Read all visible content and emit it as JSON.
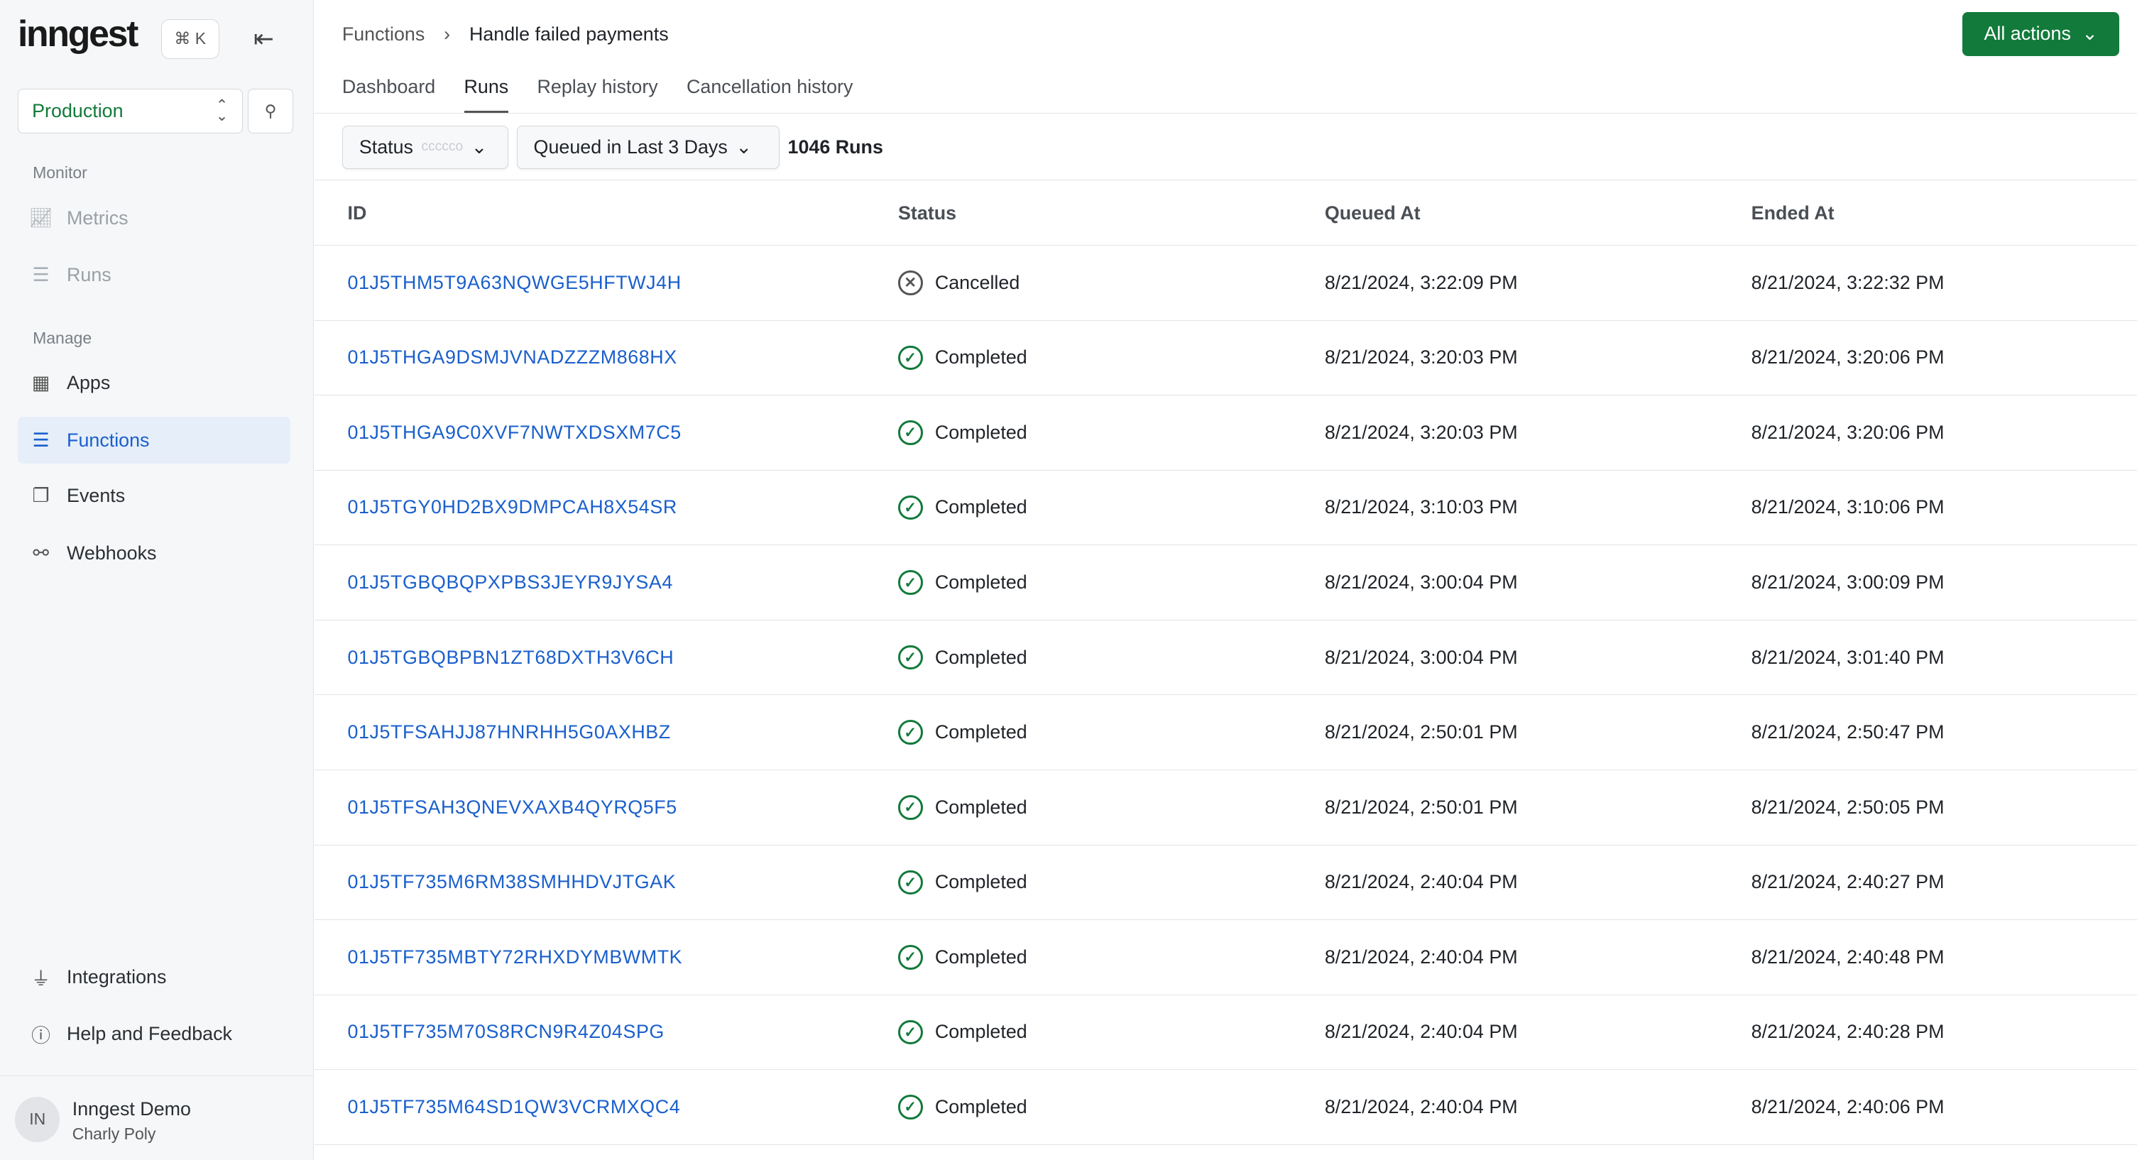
{
  "sidebar": {
    "logo": "inngest",
    "shortcut": "⌘ K",
    "environment": "Production",
    "monitor_label": "Monitor",
    "manage_label": "Manage",
    "items": {
      "metrics": "Metrics",
      "runs": "Runs",
      "apps": "Apps",
      "functions": "Functions",
      "events": "Events",
      "webhooks": "Webhooks",
      "integrations": "Integrations",
      "help": "Help and Feedback"
    },
    "user": {
      "initials": "IN",
      "name": "Inngest Demo",
      "org": "Charly Poly"
    }
  },
  "header": {
    "breadcrumb": [
      "Functions",
      "Handle failed payments"
    ],
    "all_actions": "All actions"
  },
  "tabs": [
    "Dashboard",
    "Runs",
    "Replay history",
    "Cancellation history"
  ],
  "filters": {
    "status": "Status",
    "status_placeholder": "ccccco",
    "time": "Queued in Last 3 Days",
    "count": "1046 Runs"
  },
  "table": {
    "headers": [
      "ID",
      "Status",
      "Queued At",
      "Ended At"
    ],
    "rows": [
      {
        "id": "01J5THM5T9A63NQWGE5HFTWJ4H",
        "status": "Cancelled",
        "queued": "8/21/2024, 3:22:09 PM",
        "ended": "8/21/2024, 3:22:32 PM"
      },
      {
        "id": "01J5THGA9DSMJVNADZZZM868HX",
        "status": "Completed",
        "queued": "8/21/2024, 3:20:03 PM",
        "ended": "8/21/2024, 3:20:06 PM"
      },
      {
        "id": "01J5THGA9C0XVF7NWTXDSXM7C5",
        "status": "Completed",
        "queued": "8/21/2024, 3:20:03 PM",
        "ended": "8/21/2024, 3:20:06 PM"
      },
      {
        "id": "01J5TGY0HD2BX9DMPCAH8X54SR",
        "status": "Completed",
        "queued": "8/21/2024, 3:10:03 PM",
        "ended": "8/21/2024, 3:10:06 PM"
      },
      {
        "id": "01J5TGBQBQPXPBS3JEYR9JYSA4",
        "status": "Completed",
        "queued": "8/21/2024, 3:00:04 PM",
        "ended": "8/21/2024, 3:00:09 PM"
      },
      {
        "id": "01J5TGBQBPBN1ZT68DXTH3V6CH",
        "status": "Completed",
        "queued": "8/21/2024, 3:00:04 PM",
        "ended": "8/21/2024, 3:01:40 PM"
      },
      {
        "id": "01J5TFSAHJJ87HNRHH5G0AXHBZ",
        "status": "Completed",
        "queued": "8/21/2024, 2:50:01 PM",
        "ended": "8/21/2024, 2:50:47 PM"
      },
      {
        "id": "01J5TFSAH3QNEVXAXB4QYRQ5F5",
        "status": "Completed",
        "queued": "8/21/2024, 2:50:01 PM",
        "ended": "8/21/2024, 2:50:05 PM"
      },
      {
        "id": "01J5TF735M6RM38SMHHDVJTGAK",
        "status": "Completed",
        "queued": "8/21/2024, 2:40:04 PM",
        "ended": "8/21/2024, 2:40:27 PM"
      },
      {
        "id": "01J5TF735MBTY72RHXDYMBWMTK",
        "status": "Completed",
        "queued": "8/21/2024, 2:40:04 PM",
        "ended": "8/21/2024, 2:40:48 PM"
      },
      {
        "id": "01J5TF735M70S8RCN9R4Z04SPG",
        "status": "Completed",
        "queued": "8/21/2024, 2:40:04 PM",
        "ended": "8/21/2024, 2:40:28 PM"
      },
      {
        "id": "01J5TF735M64SD1QW3VCRMXQC4",
        "status": "Completed",
        "queued": "8/21/2024, 2:40:04 PM",
        "ended": "8/21/2024, 2:40:06 PM"
      }
    ]
  },
  "colors": {
    "accent": "#127a3b",
    "link": "#1a5fcc",
    "active_bg": "#e6eefa"
  }
}
